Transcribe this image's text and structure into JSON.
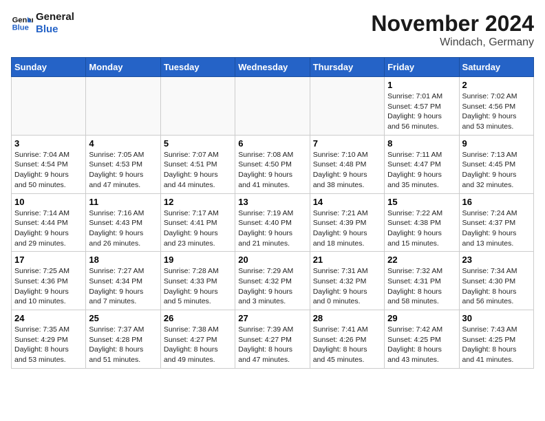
{
  "logo": {
    "line1": "General",
    "line2": "Blue"
  },
  "title": "November 2024",
  "location": "Windach, Germany",
  "weekdays": [
    "Sunday",
    "Monday",
    "Tuesday",
    "Wednesday",
    "Thursday",
    "Friday",
    "Saturday"
  ],
  "weeks": [
    [
      {
        "day": "",
        "info": ""
      },
      {
        "day": "",
        "info": ""
      },
      {
        "day": "",
        "info": ""
      },
      {
        "day": "",
        "info": ""
      },
      {
        "day": "",
        "info": ""
      },
      {
        "day": "1",
        "info": "Sunrise: 7:01 AM\nSunset: 4:57 PM\nDaylight: 9 hours\nand 56 minutes."
      },
      {
        "day": "2",
        "info": "Sunrise: 7:02 AM\nSunset: 4:56 PM\nDaylight: 9 hours\nand 53 minutes."
      }
    ],
    [
      {
        "day": "3",
        "info": "Sunrise: 7:04 AM\nSunset: 4:54 PM\nDaylight: 9 hours\nand 50 minutes."
      },
      {
        "day": "4",
        "info": "Sunrise: 7:05 AM\nSunset: 4:53 PM\nDaylight: 9 hours\nand 47 minutes."
      },
      {
        "day": "5",
        "info": "Sunrise: 7:07 AM\nSunset: 4:51 PM\nDaylight: 9 hours\nand 44 minutes."
      },
      {
        "day": "6",
        "info": "Sunrise: 7:08 AM\nSunset: 4:50 PM\nDaylight: 9 hours\nand 41 minutes."
      },
      {
        "day": "7",
        "info": "Sunrise: 7:10 AM\nSunset: 4:48 PM\nDaylight: 9 hours\nand 38 minutes."
      },
      {
        "day": "8",
        "info": "Sunrise: 7:11 AM\nSunset: 4:47 PM\nDaylight: 9 hours\nand 35 minutes."
      },
      {
        "day": "9",
        "info": "Sunrise: 7:13 AM\nSunset: 4:45 PM\nDaylight: 9 hours\nand 32 minutes."
      }
    ],
    [
      {
        "day": "10",
        "info": "Sunrise: 7:14 AM\nSunset: 4:44 PM\nDaylight: 9 hours\nand 29 minutes."
      },
      {
        "day": "11",
        "info": "Sunrise: 7:16 AM\nSunset: 4:43 PM\nDaylight: 9 hours\nand 26 minutes."
      },
      {
        "day": "12",
        "info": "Sunrise: 7:17 AM\nSunset: 4:41 PM\nDaylight: 9 hours\nand 23 minutes."
      },
      {
        "day": "13",
        "info": "Sunrise: 7:19 AM\nSunset: 4:40 PM\nDaylight: 9 hours\nand 21 minutes."
      },
      {
        "day": "14",
        "info": "Sunrise: 7:21 AM\nSunset: 4:39 PM\nDaylight: 9 hours\nand 18 minutes."
      },
      {
        "day": "15",
        "info": "Sunrise: 7:22 AM\nSunset: 4:38 PM\nDaylight: 9 hours\nand 15 minutes."
      },
      {
        "day": "16",
        "info": "Sunrise: 7:24 AM\nSunset: 4:37 PM\nDaylight: 9 hours\nand 13 minutes."
      }
    ],
    [
      {
        "day": "17",
        "info": "Sunrise: 7:25 AM\nSunset: 4:36 PM\nDaylight: 9 hours\nand 10 minutes."
      },
      {
        "day": "18",
        "info": "Sunrise: 7:27 AM\nSunset: 4:34 PM\nDaylight: 9 hours\nand 7 minutes."
      },
      {
        "day": "19",
        "info": "Sunrise: 7:28 AM\nSunset: 4:33 PM\nDaylight: 9 hours\nand 5 minutes."
      },
      {
        "day": "20",
        "info": "Sunrise: 7:29 AM\nSunset: 4:32 PM\nDaylight: 9 hours\nand 3 minutes."
      },
      {
        "day": "21",
        "info": "Sunrise: 7:31 AM\nSunset: 4:32 PM\nDaylight: 9 hours\nand 0 minutes."
      },
      {
        "day": "22",
        "info": "Sunrise: 7:32 AM\nSunset: 4:31 PM\nDaylight: 8 hours\nand 58 minutes."
      },
      {
        "day": "23",
        "info": "Sunrise: 7:34 AM\nSunset: 4:30 PM\nDaylight: 8 hours\nand 56 minutes."
      }
    ],
    [
      {
        "day": "24",
        "info": "Sunrise: 7:35 AM\nSunset: 4:29 PM\nDaylight: 8 hours\nand 53 minutes."
      },
      {
        "day": "25",
        "info": "Sunrise: 7:37 AM\nSunset: 4:28 PM\nDaylight: 8 hours\nand 51 minutes."
      },
      {
        "day": "26",
        "info": "Sunrise: 7:38 AM\nSunset: 4:27 PM\nDaylight: 8 hours\nand 49 minutes."
      },
      {
        "day": "27",
        "info": "Sunrise: 7:39 AM\nSunset: 4:27 PM\nDaylight: 8 hours\nand 47 minutes."
      },
      {
        "day": "28",
        "info": "Sunrise: 7:41 AM\nSunset: 4:26 PM\nDaylight: 8 hours\nand 45 minutes."
      },
      {
        "day": "29",
        "info": "Sunrise: 7:42 AM\nSunset: 4:25 PM\nDaylight: 8 hours\nand 43 minutes."
      },
      {
        "day": "30",
        "info": "Sunrise: 7:43 AM\nSunset: 4:25 PM\nDaylight: 8 hours\nand 41 minutes."
      }
    ]
  ]
}
